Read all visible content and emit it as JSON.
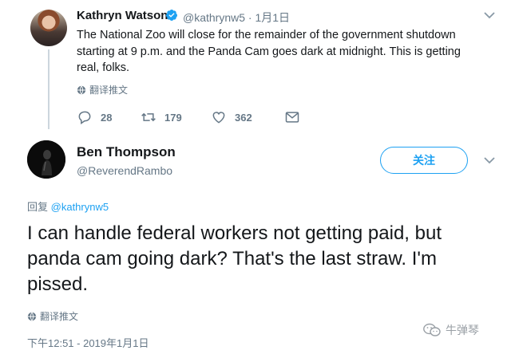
{
  "parent_tweet": {
    "author_name": "Kathryn Watson",
    "verified_icon": "verified-badge-icon",
    "handle_and_time": "@kathrynw5 · 1月1日",
    "text": "The National Zoo will close for the remainder of the government shutdown starting at 9 p.m. and the Panda Cam goes dark at midnight. This is getting real, folks.",
    "translate_label": "翻译推文",
    "reply_count": "28",
    "retweet_count": "179",
    "like_count": "362"
  },
  "main_tweet": {
    "author_name": "Ben Thompson",
    "handle": "@ReverendRambo",
    "follow_label": "关注",
    "reply_prefix": "回复",
    "reply_to_handle": "@kathrynw5",
    "text": "I can handle federal workers not getting paid, but panda cam going dark? That's the last straw. I'm pissed.",
    "translate_label": "翻译推文",
    "timestamp": "下午12:51 - 2019年1月1日"
  },
  "watermark": {
    "text": "牛弹琴"
  },
  "colors": {
    "accent": "#1da1f2",
    "secondary_text": "#657786",
    "primary_text": "#14171a"
  }
}
